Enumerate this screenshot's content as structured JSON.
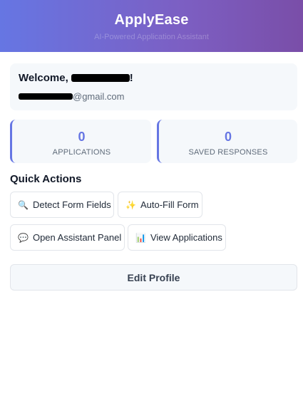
{
  "header": {
    "title": "ApplyEase",
    "subtitle": "AI-Powered Application Assistant"
  },
  "welcome": {
    "greeting_prefix": "Welcome, ",
    "greeting_suffix": "!",
    "email_domain": "@gmail.com"
  },
  "stats": [
    {
      "value": "0",
      "label": "APPLICATIONS"
    },
    {
      "value": "0",
      "label": "SAVED RESPONSES"
    }
  ],
  "quick_actions": {
    "title": "Quick Actions",
    "buttons": [
      {
        "label": "Detect Form Fields",
        "icon": "magnifier-icon",
        "glyph": "🔍"
      },
      {
        "label": "Auto-Fill Form",
        "icon": "sparkles-icon",
        "glyph": "✨"
      },
      {
        "label": "Open Assistant Panel",
        "icon": "speech-bubble-icon",
        "glyph": "💬"
      },
      {
        "label": "View Applications",
        "icon": "bar-chart-icon",
        "glyph": "📊"
      }
    ]
  },
  "edit_profile": {
    "label": "Edit Profile"
  },
  "colors": {
    "header_gradient_start": "#6676e3",
    "header_gradient_end": "#7a4ea8",
    "accent": "#6676e3",
    "card_background": "#f5f8fb"
  }
}
